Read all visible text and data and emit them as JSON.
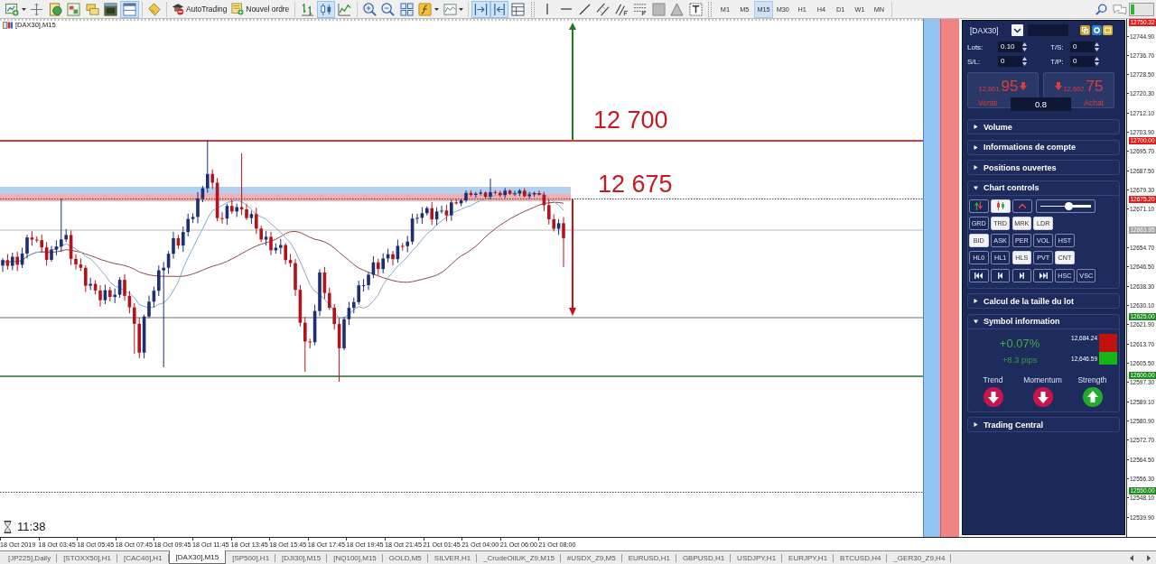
{
  "toolbar": {
    "window_toggles": [
      {
        "on": false
      },
      {
        "on": false
      },
      {
        "on": false
      },
      {
        "on": false
      },
      {
        "on": true
      },
      {
        "on": false
      }
    ],
    "buttons": [
      {
        "label": "AutoTrading"
      },
      {
        "label": "Nouvel ordre"
      }
    ],
    "chart_types": [
      {
        "selected": false
      },
      {
        "selected": true
      },
      {
        "selected": false
      }
    ],
    "chart_toggles": [
      {
        "on": true
      },
      {
        "on": true
      }
    ],
    "periods": [
      {
        "label": "M1",
        "selected": false
      },
      {
        "label": "M5",
        "selected": false
      },
      {
        "label": "M15",
        "selected": true
      },
      {
        "label": "M30",
        "selected": false
      },
      {
        "label": "H1",
        "selected": false
      },
      {
        "label": "H4",
        "selected": false
      },
      {
        "label": "D1",
        "selected": false
      },
      {
        "label": "W1",
        "selected": false
      },
      {
        "label": "MN",
        "selected": false
      }
    ]
  },
  "chart": {
    "title": "[DAX30],M15",
    "timer": "11:38",
    "level_labels": [
      {
        "label": "12 700"
      },
      {
        "label": "12 675"
      }
    ]
  },
  "price_axis": {
    "ticks": [
      "12744.90",
      "12736.70",
      "12728.50",
      "12720.30",
      "12712.10",
      "12703.90",
      "12695.70",
      "12687.50",
      "12679.30",
      "12671.10",
      "12654.70",
      "12646.50",
      "12638.30",
      "12630.10",
      "12621.90",
      "12613.70",
      "12605.50",
      "12597.30",
      "12589.10",
      "12580.90",
      "12572.70",
      "12564.50",
      "12556.30",
      "12548.10",
      "12539.90"
    ],
    "markers": [
      {
        "label": "12750.32",
        "color": "#e01b1b"
      },
      {
        "label": "12700.00",
        "color": "#e01b1b"
      },
      {
        "label": "12675.20",
        "color": "#e01b1b"
      },
      {
        "label": "12663.95",
        "color": "#a3a3a3"
      },
      {
        "label": "12625.00",
        "color": "#1d8a1d"
      },
      {
        "label": "12600.00",
        "color": "#1d8a1d"
      },
      {
        "label": "12550.00",
        "color": "#1d8a1d"
      }
    ]
  },
  "time_axis": {
    "labels": [
      "18 Oct 2019",
      "18 Oct 03:45",
      "18 Oct 05:45",
      "18 Oct 07:45",
      "18 Oct 09:45",
      "18 Oct 11:45",
      "18 Oct 13:45",
      "18 Oct 15:45",
      "18 Oct 17:45",
      "18 Oct 19:45",
      "18 Oct 21:45",
      "21 Oct 01:45",
      "21 Oct 04:00",
      "21 Oct 06:00",
      "21 Oct 08:00"
    ]
  },
  "trade_panel": {
    "symbol": "[DAX30]",
    "fields": [
      {
        "label": "Lots:",
        "value": "0.10"
      },
      {
        "label": "T/S:",
        "value": "0"
      },
      {
        "label": "S/L:",
        "value": "0"
      },
      {
        "label": "T/P:",
        "value": "0"
      }
    ],
    "sell": {
      "price_head": "12,661.",
      "price_tail": "95",
      "label": "Vente"
    },
    "buy": {
      "price_head": "12,662.",
      "price_tail": "75",
      "label": "Achat"
    },
    "spread": "0.8",
    "sections": [
      {
        "kind": "plain",
        "title": "Volume",
        "expanded": false
      },
      {
        "kind": "plain",
        "title": "Informations de compte",
        "expanded": false
      },
      {
        "kind": "plain",
        "title": "Positions ouvertes",
        "expanded": false
      },
      {
        "kind": "chart-controls",
        "title": "Chart controls",
        "expanded": true,
        "mode_buttons": [
          {
            "on": false
          },
          {
            "on": true
          },
          {
            "on": false
          }
        ],
        "zoom_slider": {
          "level": 0.57
        },
        "toggle_rows": [
          [
            {
              "label": "GRD",
              "on": false
            },
            {
              "label": "TRD",
              "on": true
            },
            {
              "label": "MRK",
              "on": true
            },
            {
              "label": "LDR",
              "on": true
            }
          ],
          [
            {
              "label": "BID",
              "on": true
            },
            {
              "label": "ASK",
              "on": false
            },
            {
              "label": "PER",
              "on": false
            },
            {
              "label": "VOL",
              "on": false
            },
            {
              "label": "HST",
              "on": false
            }
          ],
          [
            {
              "label": "HL0",
              "on": false
            },
            {
              "label": "HL1",
              "on": false
            },
            {
              "label": "HLS",
              "on": true
            },
            {
              "label": "PVT",
              "on": false
            },
            {
              "label": "CNT",
              "on": true
            }
          ]
        ],
        "scroll_toggles": [
          {
            "label": "HSC",
            "on": false
          },
          {
            "label": "VSC",
            "on": false
          }
        ]
      },
      {
        "kind": "plain",
        "title": "Calcul de la taille du lot",
        "expanded": false
      },
      {
        "kind": "symbol-info",
        "title": "Symbol information",
        "expanded": true,
        "change": "+0.07%",
        "pips": "+8.3 pips",
        "high": "12,684.24",
        "low": "12,646.59",
        "signals": [
          {
            "label": "Trend",
            "rising": false
          },
          {
            "label": "Momentum",
            "rising": false
          },
          {
            "label": "Strength",
            "rising": true
          }
        ]
      },
      {
        "kind": "plain",
        "title": "Trading Central",
        "expanded": false
      }
    ]
  },
  "tabs": [
    {
      "label": "[JP225],Daily",
      "selected": false
    },
    {
      "label": "[STOXX50],H1",
      "selected": false
    },
    {
      "label": "[CAC40],H1",
      "selected": false
    },
    {
      "label": "[DAX30],M15",
      "selected": true
    },
    {
      "label": "[SP500],H1",
      "selected": false
    },
    {
      "label": "[DJI30],M15",
      "selected": false
    },
    {
      "label": "[NQ100],M15",
      "selected": false
    },
    {
      "label": "GOLD,M5",
      "selected": false
    },
    {
      "label": "SILVER,H1",
      "selected": false
    },
    {
      "label": "_CrudeOilUK_Z9,M15",
      "selected": false
    },
    {
      "label": "#USDX_Z9,M5",
      "selected": false
    },
    {
      "label": "EURUSD,H1",
      "selected": false
    },
    {
      "label": "GBPUSD,H1",
      "selected": false
    },
    {
      "label": "USDJPY,H1",
      "selected": false
    },
    {
      "label": "EURJPY,H1",
      "selected": false
    },
    {
      "label": "BTCUSD,H4",
      "selected": false
    },
    {
      "label": "_GER30_Z9,H4",
      "selected": false
    }
  ]
}
